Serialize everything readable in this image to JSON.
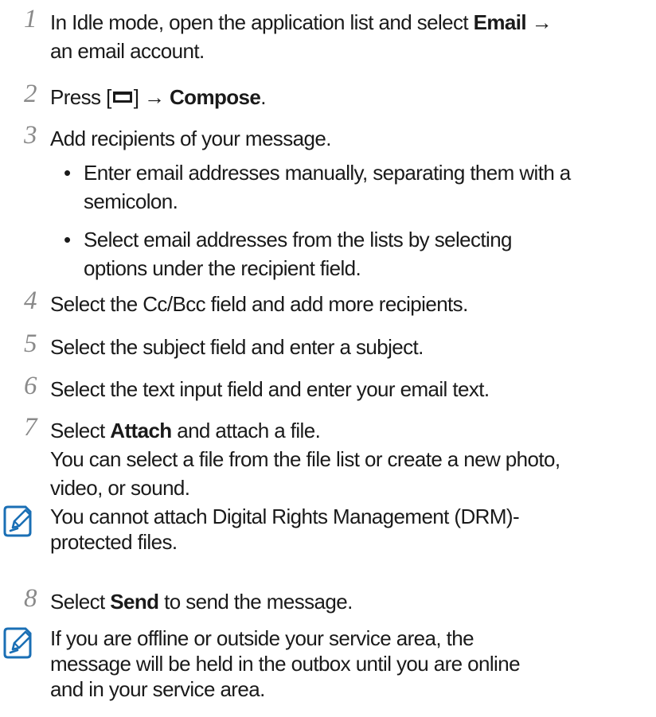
{
  "steps": [
    {
      "num": "1",
      "pre": "In Idle mode, open the application list and select ",
      "bold": "Email",
      "post": " →",
      "line2": "an email account."
    },
    {
      "num": "2",
      "pre": "Press [",
      "post1": "] → ",
      "bold": "Compose",
      "post": ".",
      "icon": "menu-key-icon"
    },
    {
      "num": "3",
      "text": "Add recipients of your message."
    },
    {
      "num": "4",
      "text": "Select the Cc/Bcc field and add more recipients."
    },
    {
      "num": "5",
      "text": "Select the subject field and enter a subject."
    },
    {
      "num": "6",
      "text": "Select the text input field and enter your email text."
    },
    {
      "num": "7",
      "pre": "Select ",
      "bold": "Attach",
      "post": " and attach a file.",
      "line2": "You can select a file from the file list or create a new photo,",
      "line3": "video, or sound."
    },
    {
      "num": "8",
      "pre": "Select ",
      "bold": "Send",
      "post": " to send the message."
    }
  ],
  "bullets": [
    {
      "marker": "•",
      "line1": "Enter email addresses manually, separating them with a",
      "line2": "semicolon."
    },
    {
      "marker": "•",
      "line1": "Select email addresses from the lists by selecting",
      "line2": "options under the recipient field."
    }
  ],
  "notes": [
    {
      "icon": "note-pencil-icon",
      "line1": "You cannot attach Digital Rights Management (DRM)-",
      "line2": "protected files."
    },
    {
      "icon": "note-pencil-icon",
      "line1": "If you are offline or outside your service area, the",
      "line2": "message will be held in the outbox until you are online",
      "line3": "and in your service area."
    }
  ]
}
